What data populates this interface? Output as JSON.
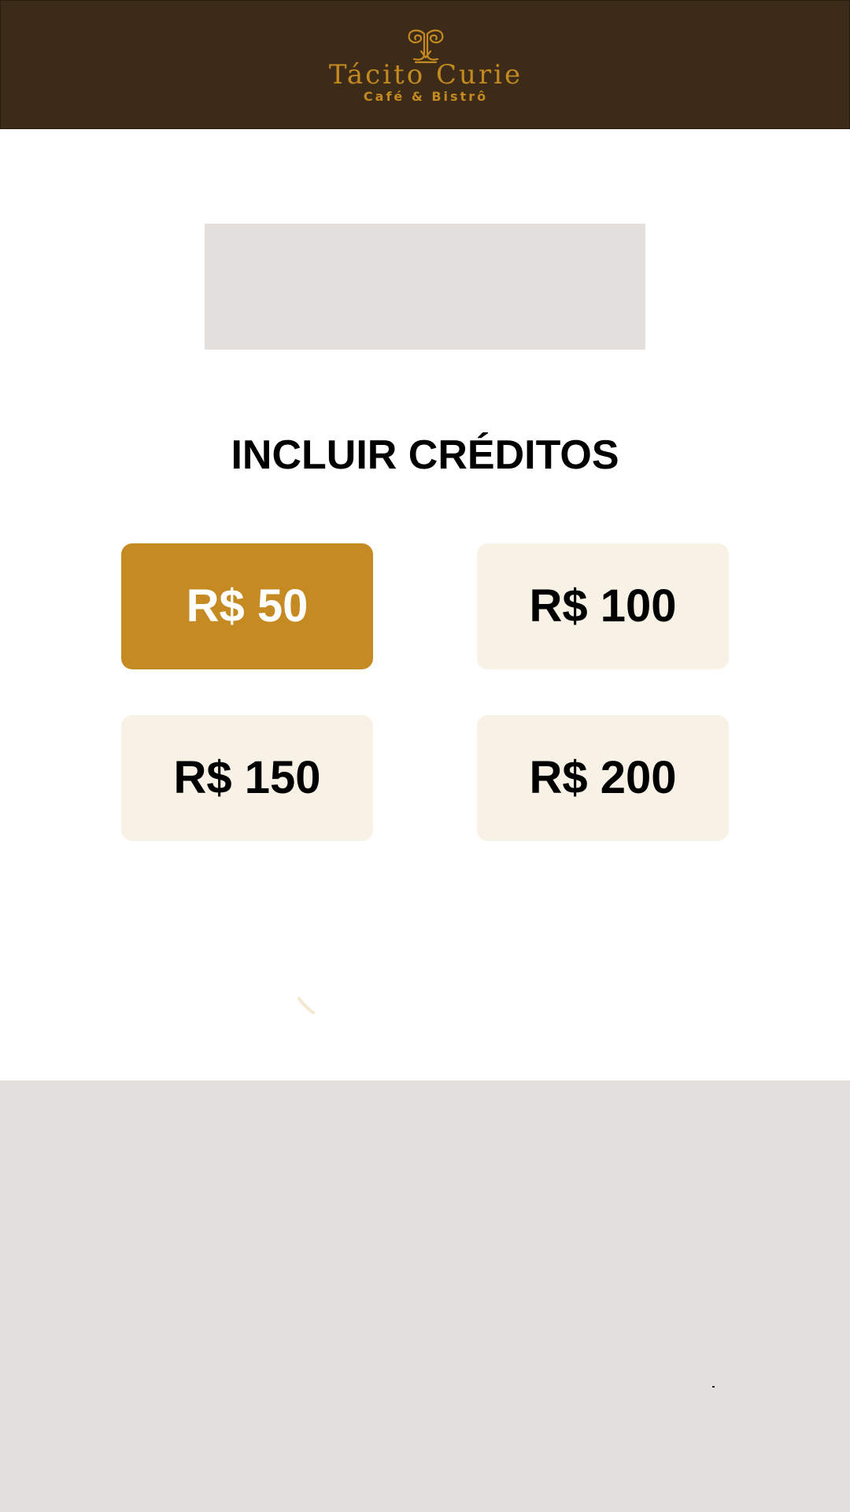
{
  "header": {
    "brand_name": "Tácito Curie",
    "tagline": "Café & Bistrô",
    "background_color": "#3d2b1a",
    "accent_color": "#c4891f",
    "logo_icon": "monogram-logo-icon"
  },
  "banner": {
    "placeholder_color": "#e3e0dd"
  },
  "main": {
    "title": "INCLUIR CRÉDITOS"
  },
  "credit_options": [
    {
      "label": "R$ 50",
      "selected": true
    },
    {
      "label": "R$ 100",
      "selected": false
    },
    {
      "label": "R$ 150",
      "selected": false
    },
    {
      "label": "R$ 200",
      "selected": false
    }
  ],
  "colors": {
    "selected_option": "#c68a22",
    "unselected_option": "#f8f1e6",
    "bottom_panel": "#e3e0dd"
  },
  "loading": {
    "icon": "loading-spinner-icon"
  }
}
